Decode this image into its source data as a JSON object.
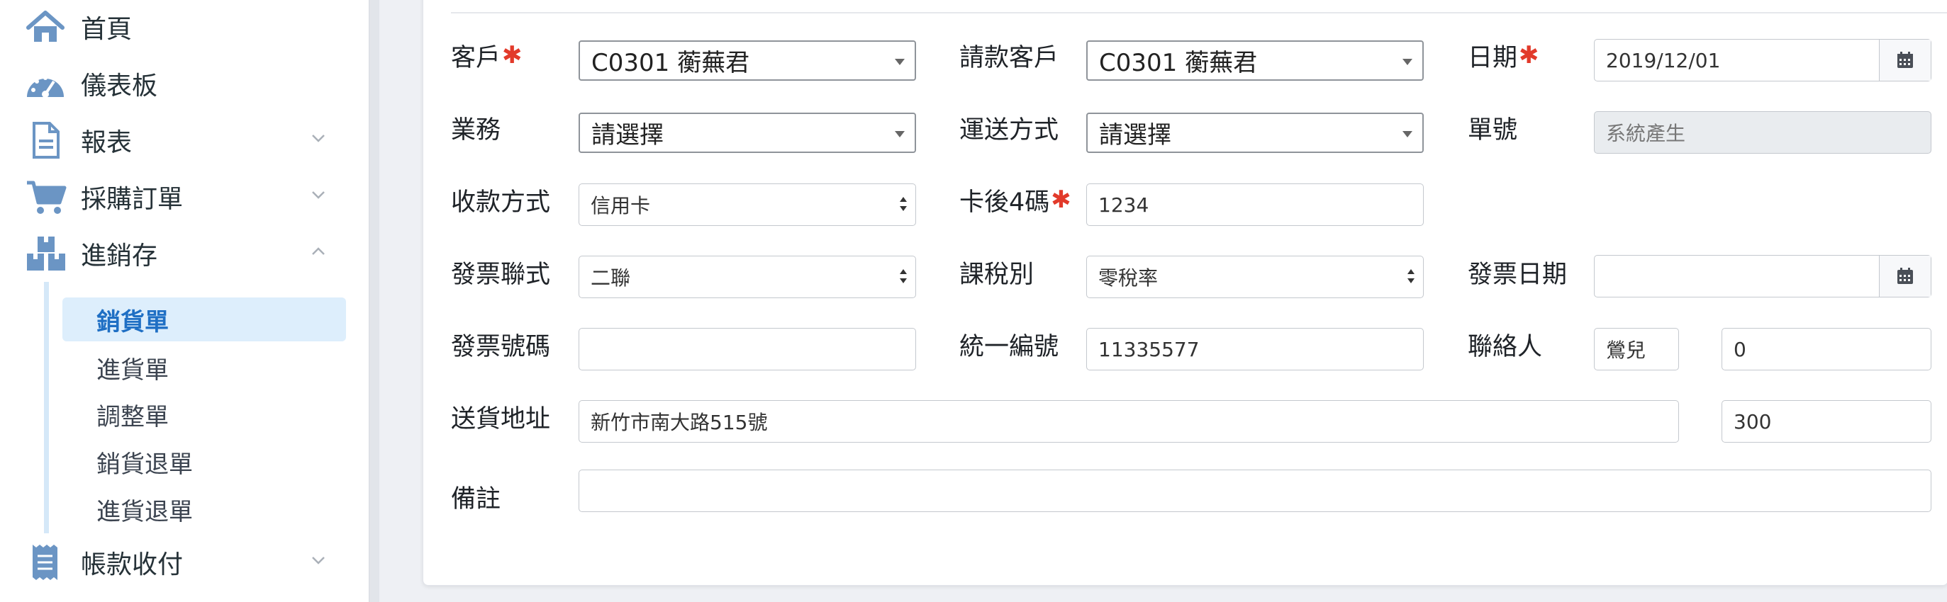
{
  "sidebar": {
    "items": [
      {
        "label": "首頁",
        "icon": "home-icon",
        "expandable": false
      },
      {
        "label": "儀表板",
        "icon": "dashboard-icon",
        "expandable": false
      },
      {
        "label": "報表",
        "icon": "report-icon",
        "expandable": true
      },
      {
        "label": "採購訂單",
        "icon": "cart-icon",
        "expandable": true
      },
      {
        "label": "進銷存",
        "icon": "inventory-icon",
        "expandable": true,
        "expanded": true
      },
      {
        "label": "帳款收付",
        "icon": "receipt-icon",
        "expandable": true
      }
    ],
    "subitems": [
      {
        "label": "銷貨單",
        "active": true
      },
      {
        "label": "進貨單"
      },
      {
        "label": "調整單"
      },
      {
        "label": "銷貨退單"
      },
      {
        "label": "進貨退單"
      }
    ]
  },
  "form": {
    "customer": {
      "label": "客戶",
      "value": "C0301 蘅蕪君",
      "required": true
    },
    "billing_customer": {
      "label": "請款客戶",
      "value": "C0301 蘅蕪君"
    },
    "date": {
      "label": "日期",
      "value": "2019/12/01",
      "required": true
    },
    "sales": {
      "label": "業務",
      "value": "請選擇"
    },
    "shipping": {
      "label": "運送方式",
      "value": "請選擇"
    },
    "order_no": {
      "label": "單號",
      "placeholder": "系統產生"
    },
    "payment": {
      "label": "收款方式",
      "value": "信用卡"
    },
    "card_last4": {
      "label": "卡後4碼",
      "value": "1234",
      "required": true
    },
    "invoice_type": {
      "label": "發票聯式",
      "value": "二聯"
    },
    "tax_type": {
      "label": "課稅別",
      "value": "零稅率"
    },
    "invoice_date": {
      "label": "發票日期",
      "value": ""
    },
    "invoice_no": {
      "label": "發票號碼",
      "value": ""
    },
    "tax_id": {
      "label": "統一編號",
      "value": "11335577"
    },
    "contact": {
      "label": "聯絡人",
      "name": "鶯兒",
      "phone": "0"
    },
    "address": {
      "label": "送貨地址",
      "value": "新竹市南大路515號",
      "zip": "300"
    },
    "note": {
      "label": "備註",
      "value": ""
    }
  },
  "colors": {
    "accent": "#1f6fc4",
    "icon": "#6b95c4",
    "required": "#e23a2a",
    "active_bg": "#ddeefc"
  }
}
